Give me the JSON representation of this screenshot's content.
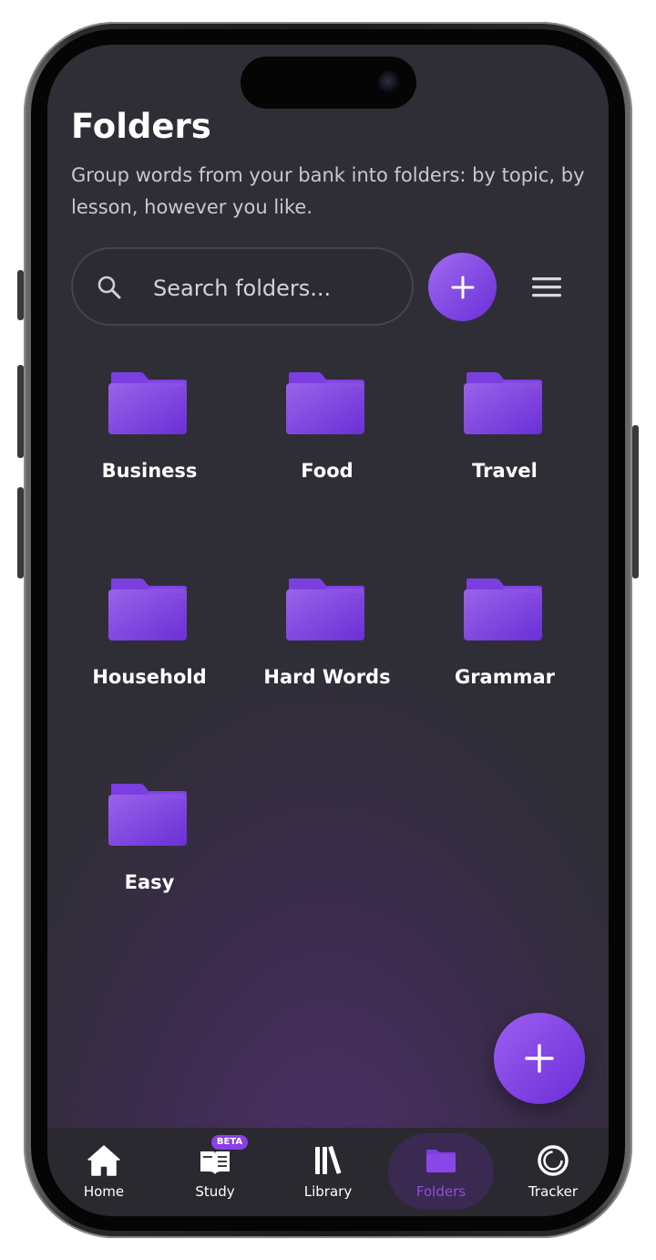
{
  "header": {
    "title": "Folders",
    "subtitle": "Group words from your bank into folders: by topic, by lesson, however you like."
  },
  "search": {
    "placeholder": "Search folders...",
    "icon": "search-icon"
  },
  "toolbar": {
    "add_icon": "plus-icon",
    "menu_icon": "hamburger-menu-icon"
  },
  "folders": [
    {
      "label": "Business"
    },
    {
      "label": "Food"
    },
    {
      "label": "Travel"
    },
    {
      "label": "Household"
    },
    {
      "label": "Hard Words"
    },
    {
      "label": "Grammar"
    },
    {
      "label": "Easy"
    }
  ],
  "fab": {
    "icon": "plus-icon"
  },
  "nav": {
    "items": [
      {
        "label": "Home",
        "icon": "home-icon"
      },
      {
        "label": "Study",
        "icon": "book-icon",
        "badge": "BETA"
      },
      {
        "label": "Library",
        "icon": "library-icon"
      },
      {
        "label": "Folders",
        "icon": "folder-icon",
        "active": true
      },
      {
        "label": "Tracker",
        "icon": "tracker-ring-icon"
      }
    ]
  },
  "colors": {
    "accent": "#7c3aed",
    "accent_light": "#a06af0",
    "background": "#2f2e36",
    "nav_active": "#8c4fe0"
  }
}
